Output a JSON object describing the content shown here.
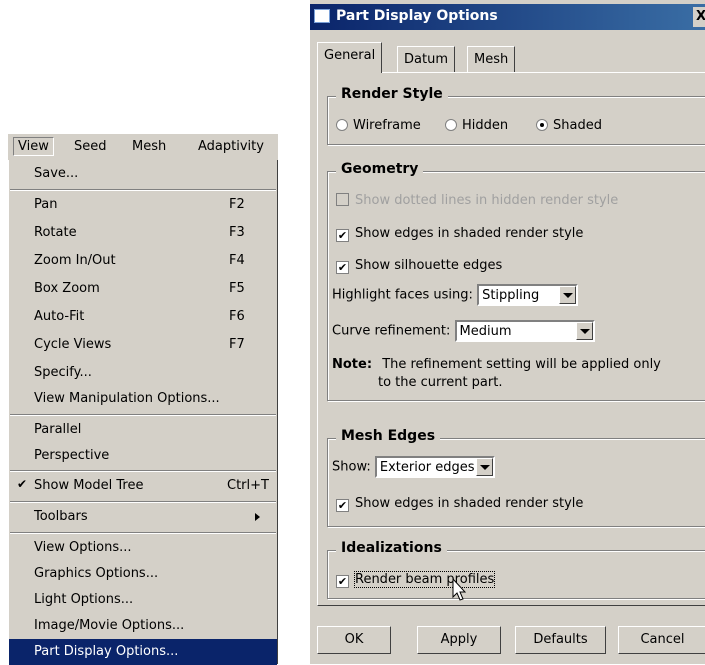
{
  "menubar": {
    "items": [
      "View",
      "Seed",
      "Mesh",
      "Adaptivity"
    ]
  },
  "view_menu": {
    "items": [
      {
        "label": "Save...",
        "shortcut": ""
      },
      {
        "label": "Pan",
        "shortcut": "F2"
      },
      {
        "label": "Rotate",
        "shortcut": "F3"
      },
      {
        "label": "Zoom In/Out",
        "shortcut": "F4"
      },
      {
        "label": "Box Zoom",
        "shortcut": "F5"
      },
      {
        "label": "Auto-Fit",
        "shortcut": "F6"
      },
      {
        "label": "Cycle Views",
        "shortcut": "F7"
      },
      {
        "label": "Specify...",
        "shortcut": ""
      },
      {
        "label": "View Manipulation Options...",
        "shortcut": ""
      },
      {
        "label": "Parallel",
        "shortcut": ""
      },
      {
        "label": "Perspective",
        "shortcut": ""
      },
      {
        "label": "Show Model Tree",
        "shortcut": "Ctrl+T",
        "checked": true
      },
      {
        "label": "Toolbars",
        "shortcut": "",
        "submenu": true
      },
      {
        "label": "View Options...",
        "shortcut": ""
      },
      {
        "label": "Graphics Options...",
        "shortcut": ""
      },
      {
        "label": "Light Options...",
        "shortcut": ""
      },
      {
        "label": "Image/Movie Options...",
        "shortcut": ""
      },
      {
        "label": "Part Display Options...",
        "shortcut": "",
        "selected": true
      }
    ]
  },
  "dialog": {
    "title": "Part Display Options",
    "close": "X",
    "tabs": [
      "General",
      "Datum",
      "Mesh"
    ],
    "active_tab": "General",
    "render_style": {
      "legend": "Render Style",
      "options": [
        "Wireframe",
        "Hidden",
        "Shaded"
      ],
      "selected": "Shaded"
    },
    "geometry": {
      "legend": "Geometry",
      "dotted_lines": {
        "label": "Show dotted lines in hidden render style",
        "checked": false,
        "enabled": false
      },
      "edges_shaded": {
        "label": "Show edges in shaded render style",
        "checked": true
      },
      "silhouette": {
        "label": "Show silhouette edges",
        "checked": true
      },
      "highlight_label": "Highlight faces using:",
      "highlight_value": "Stippling",
      "curve_label": "Curve refinement:",
      "curve_value": "Medium",
      "note_label": "Note:",
      "note_line1": "The refinement setting will be applied only",
      "note_line2": "to the current part."
    },
    "mesh_edges": {
      "legend": "Mesh Edges",
      "show_label": "Show:",
      "show_value": "Exterior edges",
      "edges_shaded": {
        "label": "Show edges in shaded render style",
        "checked": true
      }
    },
    "idealizations": {
      "legend": "Idealizations",
      "beam_profiles": {
        "label": "Render beam profiles",
        "checked": true
      }
    },
    "buttons": {
      "ok": "OK",
      "apply": "Apply",
      "defaults": "Defaults",
      "cancel": "Cancel"
    },
    "check_mark": "✔"
  },
  "colors": {
    "menu_bg": "#d4d0c8",
    "selection": "#0a246a",
    "title_gradient_end": "#3a6ea5"
  }
}
